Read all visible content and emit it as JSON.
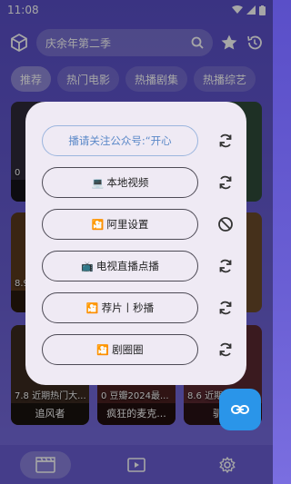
{
  "status": {
    "time": "11:08"
  },
  "search": {
    "query": "庆余年第二季"
  },
  "tabs": [
    {
      "label": "推荐",
      "active": true
    },
    {
      "label": "热门电影",
      "active": false
    },
    {
      "label": "热播剧集",
      "active": false
    },
    {
      "label": "热播综艺",
      "active": false
    }
  ],
  "cards": [
    {
      "meta": "0",
      "title": "",
      "row": 0,
      "col": 0
    },
    {
      "meta": "8.9",
      "title": "",
      "row": 1,
      "col": 0
    },
    {
      "meta": "7.8 近期热门大...",
      "title": "追风者",
      "row": 2,
      "col": 0
    },
    {
      "meta": "0 豆瓣2024最...",
      "title": "疯狂的麦克...",
      "row": 2,
      "col": 1
    },
    {
      "meta": "8.6 近期热门...",
      "title": "驯鹿",
      "row": 2,
      "col": 2
    }
  ],
  "dialog": {
    "items": [
      {
        "label": "播请关注公众号:“开心",
        "icon": "",
        "action": "refresh-icon"
      },
      {
        "label": "本地视频",
        "icon": "💻",
        "action": "refresh-icon"
      },
      {
        "label": "阿里设置",
        "icon": "🎦",
        "action": "block-icon"
      },
      {
        "label": "电视直播点播",
        "icon": "📺",
        "action": "refresh-icon"
      },
      {
        "label": "荐片丨秒播",
        "icon": "🎦",
        "action": "refresh-icon"
      },
      {
        "label": "剧圈圈",
        "icon": "🎦",
        "action": "refresh-icon"
      }
    ]
  },
  "colors": {
    "accent": "#5a4fc8",
    "fab": "#2a95e9",
    "dialog_bg": "#efeaf4"
  },
  "nav": [
    {
      "icon": "clapperboard-icon",
      "active": true
    },
    {
      "icon": "play-icon",
      "active": false
    },
    {
      "icon": "gear-icon",
      "active": false
    }
  ]
}
